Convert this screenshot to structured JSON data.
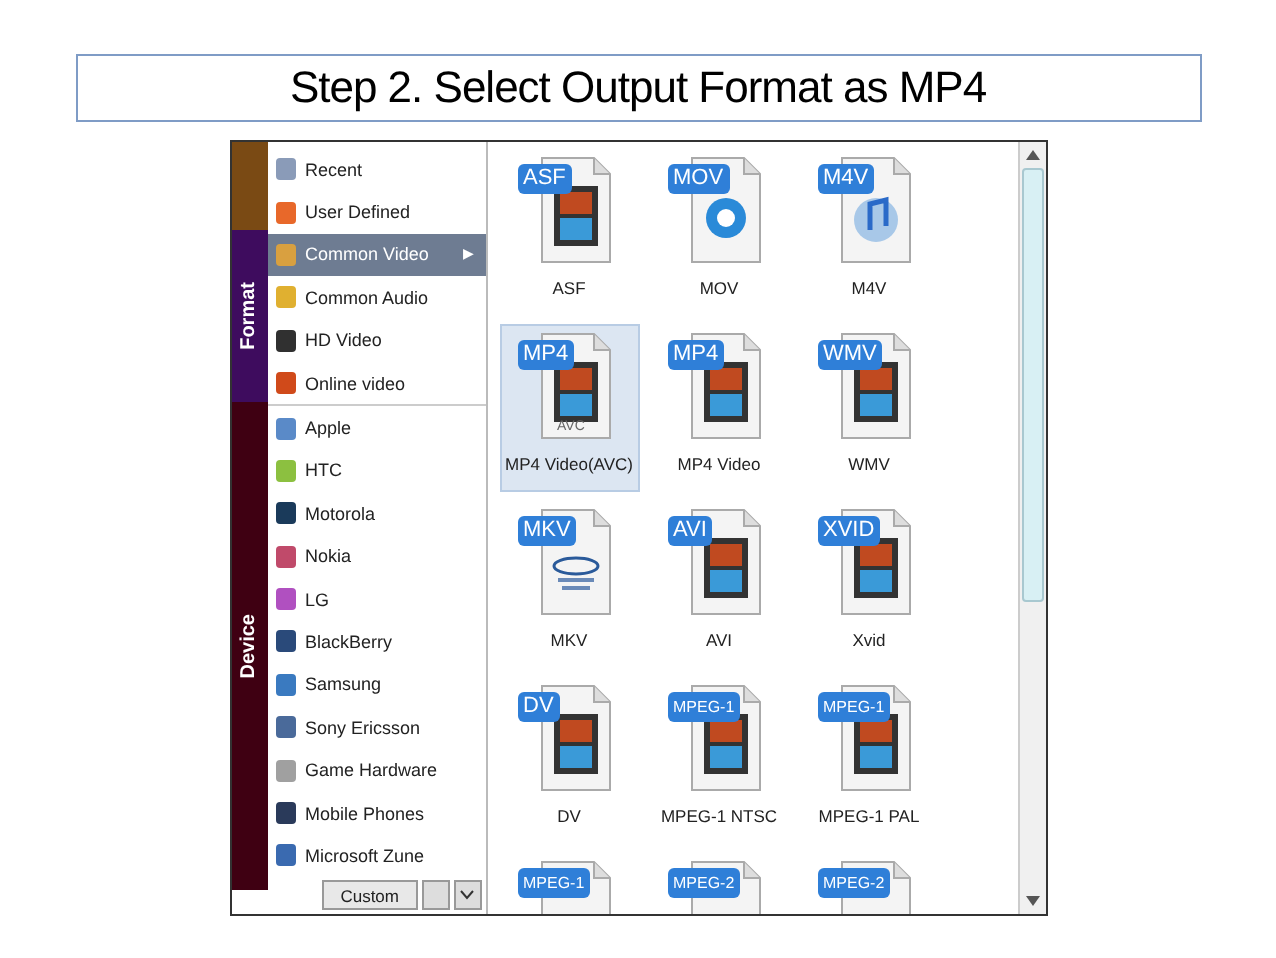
{
  "title": "Step 2. Select Output Format as MP4",
  "side_tabs": [
    {
      "label": "Format",
      "kind": "format"
    },
    {
      "label": "Device",
      "kind": "device"
    }
  ],
  "format_items": [
    {
      "label": "Recent",
      "selected": false,
      "color": "#8a9bb8"
    },
    {
      "label": "User Defined",
      "selected": false,
      "color": "#e8682a"
    },
    {
      "label": "Common Video",
      "selected": true,
      "color": "#d9a040"
    },
    {
      "label": "Common Audio",
      "selected": false,
      "color": "#e0b030"
    },
    {
      "label": "HD Video",
      "selected": false,
      "color": "#303030"
    },
    {
      "label": "Online video",
      "selected": false,
      "color": "#d04a1a"
    }
  ],
  "submenu_arrow": "▶",
  "device_items": [
    {
      "label": "Apple",
      "color": "#5a8ac8"
    },
    {
      "label": "HTC",
      "color": "#8cc040"
    },
    {
      "label": "Motorola",
      "color": "#1a3a5a"
    },
    {
      "label": "Nokia",
      "color": "#c04a6a"
    },
    {
      "label": "LG",
      "color": "#b050c0"
    },
    {
      "label": "BlackBerry",
      "color": "#2a4a7a"
    },
    {
      "label": "Samsung",
      "color": "#3a7ac0"
    },
    {
      "label": "Sony Ericsson",
      "color": "#4a6a9a"
    },
    {
      "label": "Game Hardware",
      "color": "#a0a0a0"
    },
    {
      "label": "Mobile Phones",
      "color": "#2a3a5a"
    },
    {
      "label": "Microsoft Zune",
      "color": "#3a6ab0"
    }
  ],
  "custom_button": "Custom",
  "formats": [
    {
      "badge": "ASF",
      "label": "ASF",
      "kind": "film",
      "selected": false
    },
    {
      "badge": "MOV",
      "label": "MOV",
      "kind": "quicktime",
      "selected": false
    },
    {
      "badge": "M4V",
      "label": "M4V",
      "kind": "music",
      "selected": false
    },
    {
      "badge": "MP4",
      "label": "MP4 Video(AVC)",
      "kind": "film",
      "sublabel": "AVC",
      "selected": true
    },
    {
      "badge": "MP4",
      "label": "MP4 Video",
      "kind": "film",
      "selected": false
    },
    {
      "badge": "WMV",
      "label": "WMV",
      "kind": "film",
      "selected": false
    },
    {
      "badge": "MKV",
      "label": "MKV",
      "kind": "mkv",
      "selected": false
    },
    {
      "badge": "AVI",
      "label": "AVI",
      "kind": "film",
      "selected": false
    },
    {
      "badge": "XVID",
      "label": "Xvid",
      "kind": "film",
      "selected": false
    },
    {
      "badge": "DV",
      "label": "DV",
      "kind": "film",
      "selected": false
    },
    {
      "badge": "MPEG-1",
      "label": "MPEG-1 NTSC",
      "kind": "film",
      "selected": false
    },
    {
      "badge": "MPEG-1",
      "label": "MPEG-1 PAL",
      "kind": "film",
      "selected": false
    }
  ],
  "partial_formats": [
    {
      "badge": "MPEG-1"
    },
    {
      "badge": "MPEG-2"
    },
    {
      "badge": "MPEG-2"
    }
  ]
}
